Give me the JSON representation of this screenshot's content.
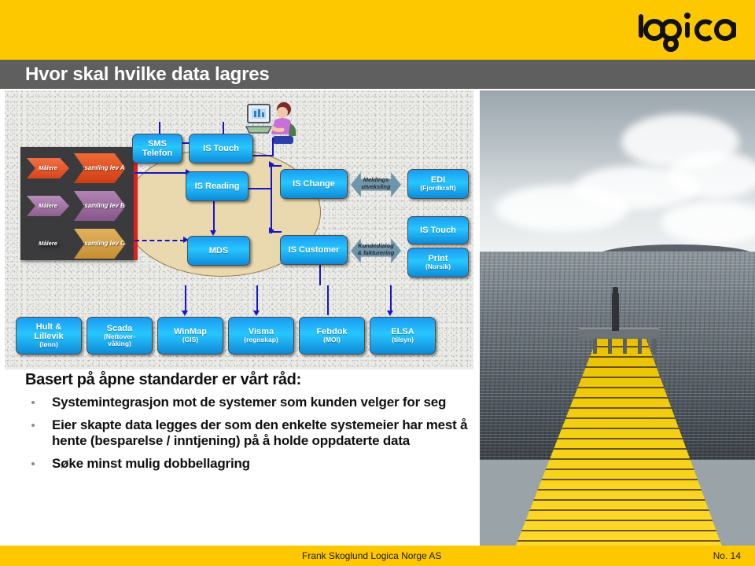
{
  "header": {
    "title": "Hvor skal hvilke data lagres",
    "logo_text": "logica",
    "band_color": "#fdc800",
    "title_bar_color": "#5f5f5f"
  },
  "diagram": {
    "collection_panel": {
      "rows": [
        {
          "meter_label": "Målere",
          "collector_label": "Innsamling lev A",
          "color": "#e2532a"
        },
        {
          "meter_label": "Målere",
          "collector_label": "Innsamling lev B",
          "color": "#9d6f9e"
        },
        {
          "meter_label": "Målere",
          "collector_label": "Innsamling lev C",
          "color": "#d9a busy"
        }
      ]
    },
    "top_boxes": [
      {
        "l1": "SMS",
        "l2": "Telefon"
      },
      {
        "l1": "IS Touch",
        "l2": ""
      }
    ],
    "core_boxes": [
      {
        "l1": "IS Reading",
        "l2": ""
      },
      {
        "l1": "MDS",
        "l2": ""
      },
      {
        "l1": "IS Change",
        "l2": ""
      },
      {
        "l1": "IS Customer",
        "l2": ""
      }
    ],
    "exchange_arrows": [
      {
        "line1": "Meldings",
        "line2": "utveksling"
      },
      {
        "line1": "Kundedialog",
        "line2": "& fakturering"
      }
    ],
    "right_boxes": [
      {
        "l1": "EDI",
        "l2": "(Fjordkraft)"
      },
      {
        "l1": "IS Touch",
        "l2": ""
      },
      {
        "l1": "Print",
        "l2": "(Norsik)"
      }
    ],
    "bottom_boxes": [
      {
        "l1": "Hult &",
        "l1b": "Lillevik",
        "l2": "(lønn)"
      },
      {
        "l1": "Scada",
        "l1b": "(Nettover-",
        "l2": "våking)"
      },
      {
        "l1": "WinMap",
        "l1b": "",
        "l2": "(GIS)"
      },
      {
        "l1": "Visma",
        "l1b": "",
        "l2": "(regnskap)"
      },
      {
        "l1": "Febdok",
        "l1b": "",
        "l2": "(MOI)"
      },
      {
        "l1": "ELSA",
        "l1b": "",
        "l2": "(tilsyn)"
      }
    ]
  },
  "content": {
    "lead": "Basert på åpne standarder er vårt råd:",
    "bullets": [
      "Systemintegrasjon mot de systemer som kunden velger for seg",
      "Eier skapte data legges der som den enkelte systemeier har mest å hente (besparelse / inntjening) på å holde oppdaterte data",
      "Søke minst mulig dobbellagring"
    ]
  },
  "footer": {
    "author": "Frank Skoglund   Logica Norge AS",
    "page": "No. 14"
  }
}
